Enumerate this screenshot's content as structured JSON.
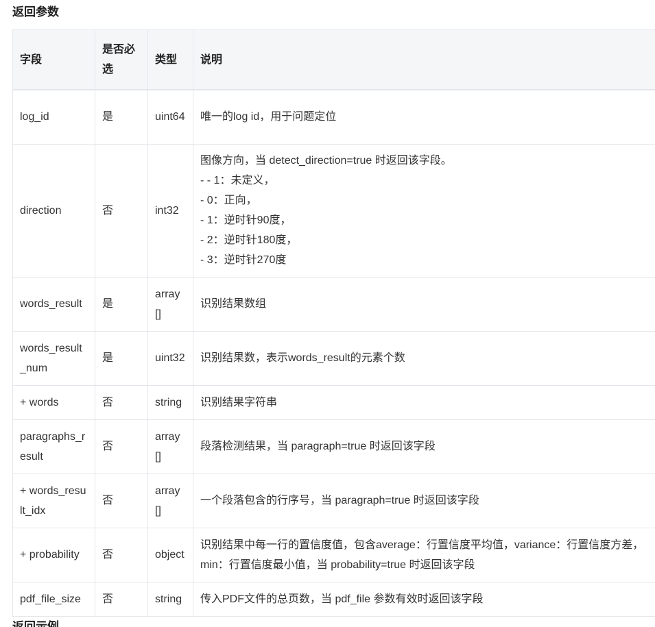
{
  "section_title": "返回参数",
  "next_section_title": "返回示例",
  "table": {
    "headers": {
      "field": "字段",
      "required": "是否必选",
      "type": "类型",
      "description": "说明"
    },
    "rows": [
      {
        "field": "log_id",
        "required": "是",
        "type": "uint64",
        "description": "唯一的log id，用于问题定位"
      },
      {
        "field": "direction",
        "required": "否",
        "type": "int32",
        "description_lines": [
          "图像方向，当 detect_direction=true 时返回该字段。",
          "- - 1：未定义，",
          "- 0：正向，",
          "- 1：逆时针90度，",
          "- 2：逆时针180度，",
          "- 3：逆时针270度"
        ]
      },
      {
        "field": "words_result",
        "required": "是",
        "type": "array[]",
        "description": "识别结果数组"
      },
      {
        "field": "words_result_num",
        "required": "是",
        "type": "uint32",
        "description": "识别结果数，表示words_result的元素个数"
      },
      {
        "field": "+ words",
        "required": "否",
        "type": "string",
        "description": "识别结果字符串"
      },
      {
        "field": "paragraphs_result",
        "required": "否",
        "type": "array[]",
        "description": "段落检测结果，当 paragraph=true 时返回该字段"
      },
      {
        "field": "+ words_result_idx",
        "required": "否",
        "type": "array[]",
        "description": "一个段落包含的行序号，当 paragraph=true 时返回该字段"
      },
      {
        "field": "+ probability",
        "required": "否",
        "type": "object",
        "description": "识别结果中每一行的置信度值，包含average：行置信度平均值，variance：行置信度方差，min：行置信度最小值，当 probability=true 时返回该字段"
      },
      {
        "field": "pdf_file_size",
        "required": "否",
        "type": "string",
        "description": "传入PDF文件的总页数，当 pdf_file 参数有效时返回该字段"
      }
    ]
  }
}
